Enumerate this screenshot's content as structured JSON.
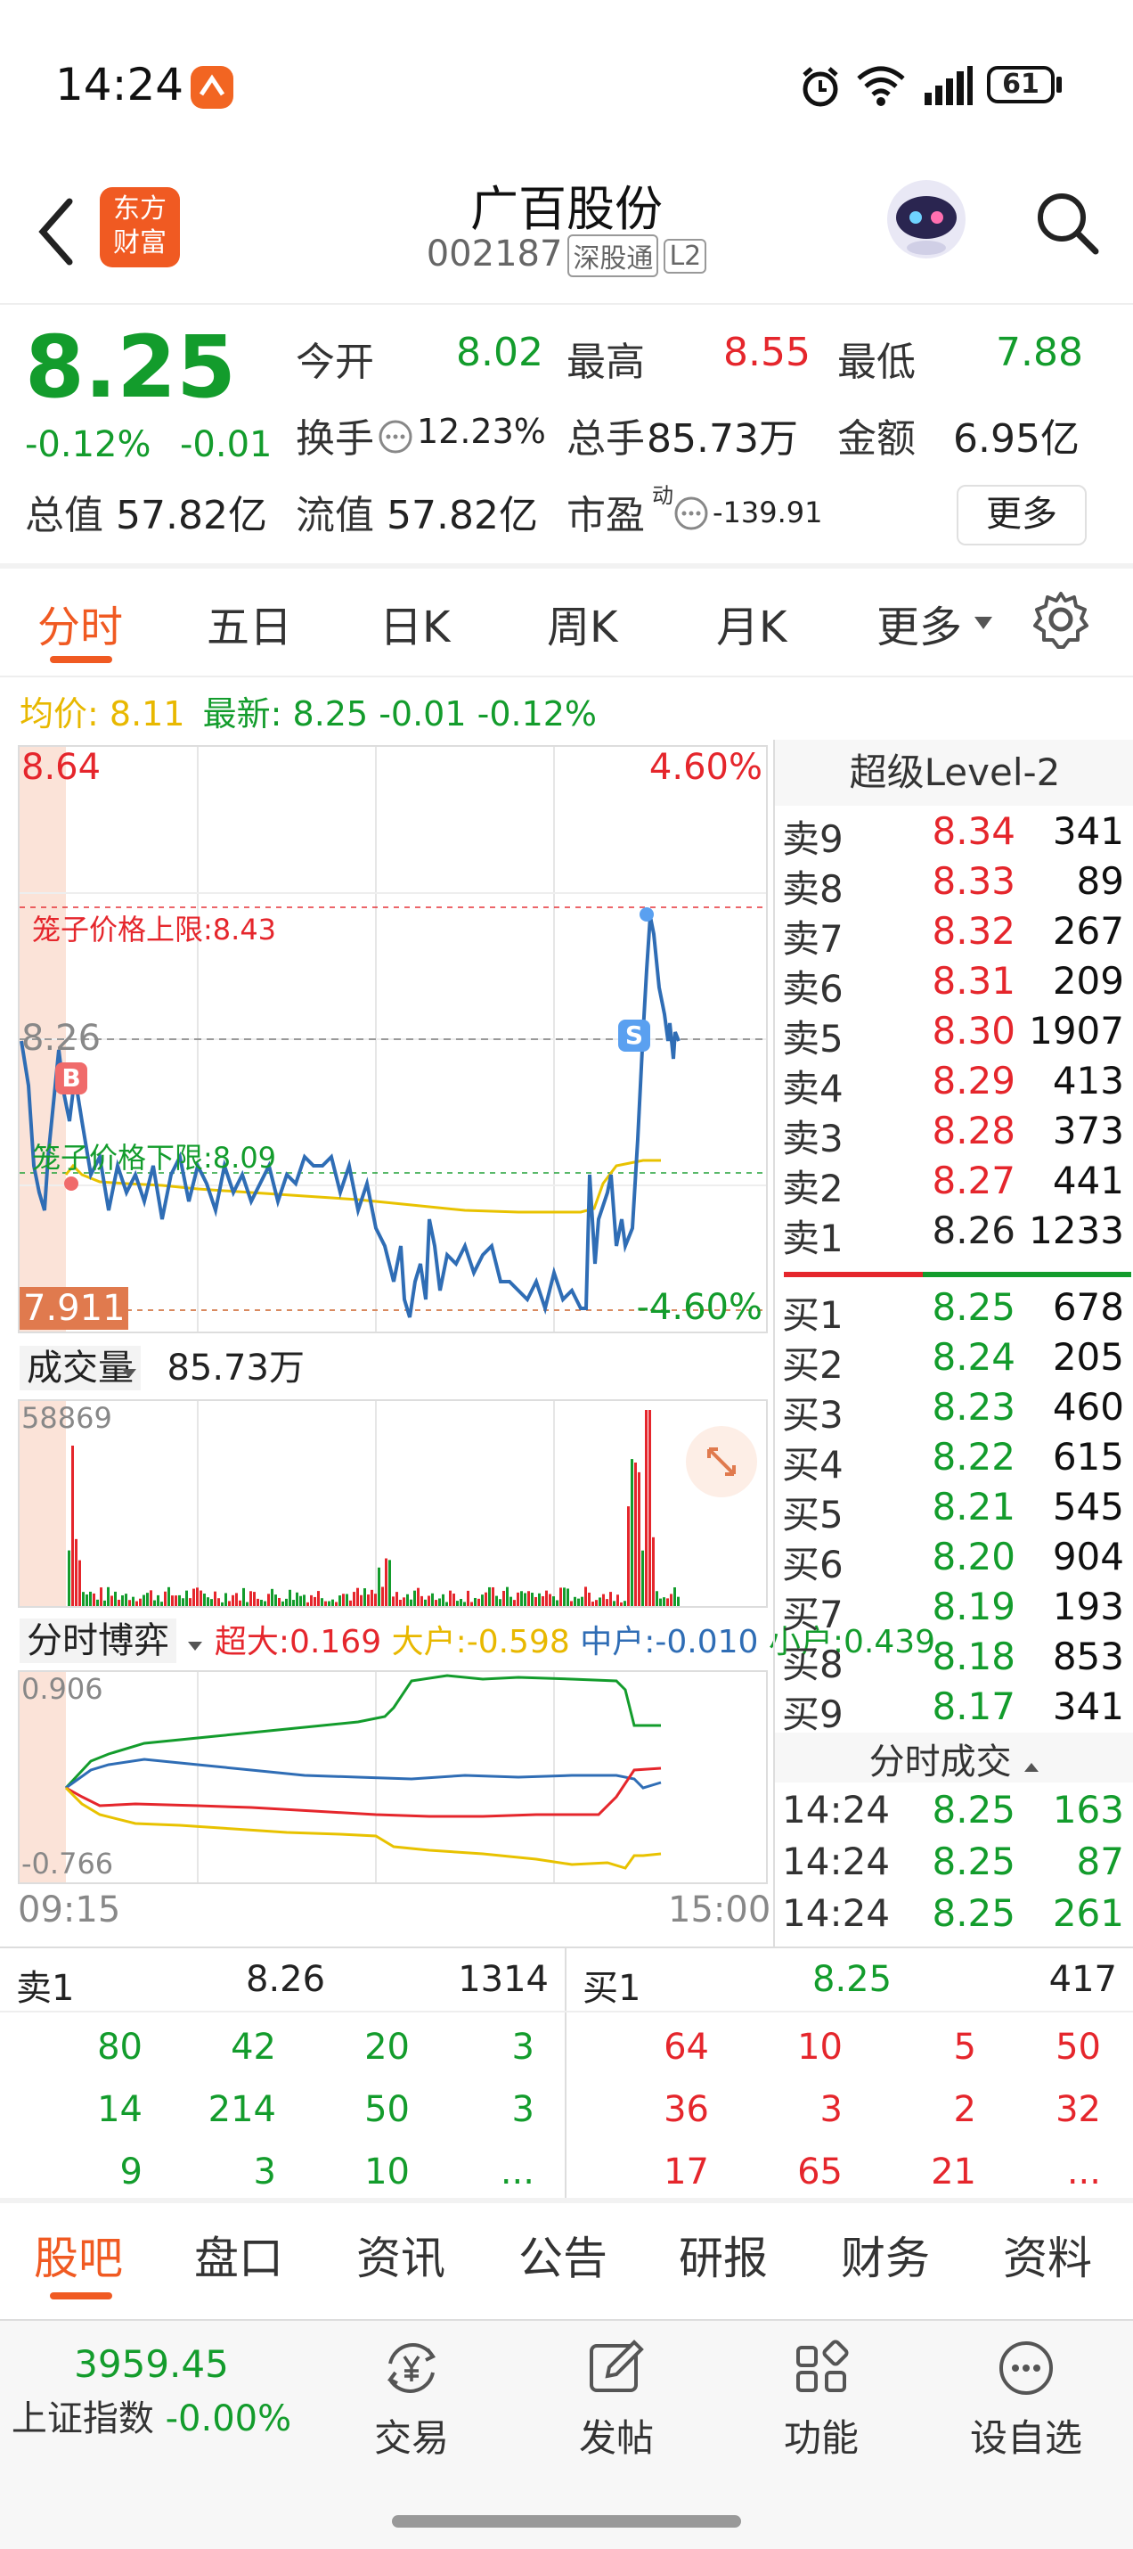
{
  "status_bar": {
    "time": "14:24",
    "battery": "61"
  },
  "header": {
    "title": "广百股份",
    "code": "002187",
    "tag1": "深股通",
    "tag2": "L2",
    "logo_text": "东方财富"
  },
  "quote": {
    "price": "8.25",
    "change_pct": "-0.12%",
    "change": "-0.01",
    "open_label": "今开",
    "open": "8.02",
    "high_label": "最高",
    "high": "8.55",
    "low_label": "最低",
    "low": "7.88",
    "turnover_label": "换手",
    "turnover": "12.23%",
    "volume_label": "总手",
    "volume": "85.73万",
    "amount_label": "金额",
    "amount": "6.95亿",
    "mcap_label": "总值",
    "mcap": "57.82亿",
    "float_label": "流值",
    "float": "57.82亿",
    "pe_label": "市盈",
    "pe_sup": "动",
    "pe": "-139.91",
    "more_button": "更多"
  },
  "tabs": [
    "分时",
    "五日",
    "日K",
    "周K",
    "月K",
    "更多"
  ],
  "chart_header": {
    "avg_label": "均价:",
    "avg": "8.11",
    "last_label": "最新:",
    "last": "8.25 -0.01 -0.12%"
  },
  "chart_labels": {
    "top_price": "8.64",
    "top_pct": "4.60%",
    "bottom_price": "7.911",
    "bottom_pct": "-4.60%",
    "mid_price": "8.26",
    "upper_limit": "笼子价格上限:8.43",
    "lower_limit": "笼子价格下限:8.09",
    "buy_marker": "B",
    "sell_marker": "S"
  },
  "volume_panel": {
    "label": "成交量",
    "value": "85.73万",
    "max": "58869"
  },
  "flow_panel": {
    "label": "分时博弈",
    "items": [
      {
        "name": "超大:",
        "value": "0.169",
        "color": "#e5262c"
      },
      {
        "name": "大户:",
        "value": "-0.598",
        "color": "#e8b800"
      },
      {
        "name": "中户:",
        "value": "-0.010",
        "color": "#2f6db5"
      },
      {
        "name": "小户:",
        "value": "0.439",
        "color": "#139c2c"
      }
    ],
    "max": "0.906",
    "min": "-0.766",
    "time_start": "09:15",
    "time_end": "15:00"
  },
  "order_book": {
    "title": "超级Level-2",
    "asks": [
      {
        "label": "卖9",
        "price": "8.34",
        "vol": "341"
      },
      {
        "label": "卖8",
        "price": "8.33",
        "vol": "89"
      },
      {
        "label": "卖7",
        "price": "8.32",
        "vol": "267"
      },
      {
        "label": "卖6",
        "price": "8.31",
        "vol": "209"
      },
      {
        "label": "卖5",
        "price": "8.30",
        "vol": "1907"
      },
      {
        "label": "卖4",
        "price": "8.29",
        "vol": "413"
      },
      {
        "label": "卖3",
        "price": "8.28",
        "vol": "373"
      },
      {
        "label": "卖2",
        "price": "8.27",
        "vol": "441"
      },
      {
        "label": "卖1",
        "price": "8.26",
        "vol": "1233"
      }
    ],
    "bids": [
      {
        "label": "买1",
        "price": "8.25",
        "vol": "678"
      },
      {
        "label": "买2",
        "price": "8.24",
        "vol": "205"
      },
      {
        "label": "买3",
        "price": "8.23",
        "vol": "460"
      },
      {
        "label": "买4",
        "price": "8.22",
        "vol": "615"
      },
      {
        "label": "买5",
        "price": "8.21",
        "vol": "545"
      },
      {
        "label": "买6",
        "price": "8.20",
        "vol": "904"
      },
      {
        "label": "买7",
        "price": "8.19",
        "vol": "193"
      },
      {
        "label": "买8",
        "price": "8.18",
        "vol": "853"
      },
      {
        "label": "买9",
        "price": "8.17",
        "vol": "341"
      }
    ],
    "ticks_title": "分时成交",
    "ticks": [
      {
        "time": "14:24",
        "price": "8.25",
        "vol": "163"
      },
      {
        "time": "14:24",
        "price": "8.25",
        "vol": "87"
      },
      {
        "time": "14:24",
        "price": "8.25",
        "vol": "261"
      }
    ]
  },
  "queue": {
    "sell_label": "卖1",
    "sell_price": "8.26",
    "sell_total": "1314",
    "sell_rows": [
      [
        "80",
        "42",
        "20",
        "3"
      ],
      [
        "14",
        "214",
        "50",
        "3"
      ],
      [
        "9",
        "3",
        "10",
        "..."
      ]
    ],
    "buy_label": "买1",
    "buy_price": "8.25",
    "buy_total": "417",
    "buy_rows": [
      [
        "64",
        "10",
        "5",
        "50"
      ],
      [
        "36",
        "3",
        "2",
        "32"
      ],
      [
        "17",
        "65",
        "21",
        "..."
      ]
    ]
  },
  "bottom_tabs": [
    "股吧",
    "盘口",
    "资讯",
    "公告",
    "研报",
    "财务",
    "资料"
  ],
  "nav": {
    "index_value": "3959.45",
    "index_name": "上证指数",
    "index_change": "-0.00%",
    "items": [
      "交易",
      "发帖",
      "功能",
      "设自选"
    ]
  }
}
